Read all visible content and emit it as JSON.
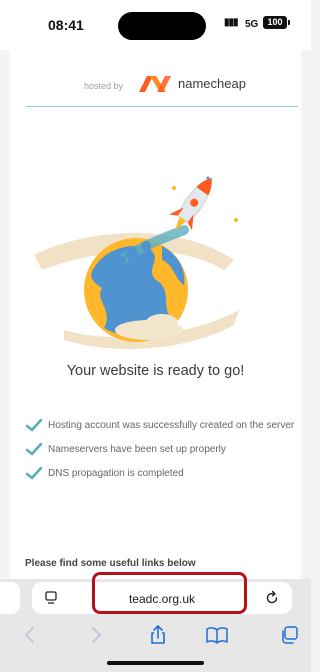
{
  "status_bar": {
    "time": "08:41",
    "network": "5G",
    "battery": "100"
  },
  "page": {
    "hosted_by": "hosted by",
    "brand": "namecheap",
    "headline": "Your website is ready to go!",
    "checks": [
      "Hosting account was successfully created on the server",
      "Nameservers have been set up properly",
      "DNS propagation is completed"
    ],
    "useful_links": "Please find some useful links below"
  },
  "browser": {
    "url": "teadc.org.uk"
  },
  "colors": {
    "accent_orange": "#ff5a1f",
    "check_teal": "#5aafbd",
    "highlight_red": "#b5121b",
    "divider": "#8ccbd2"
  }
}
